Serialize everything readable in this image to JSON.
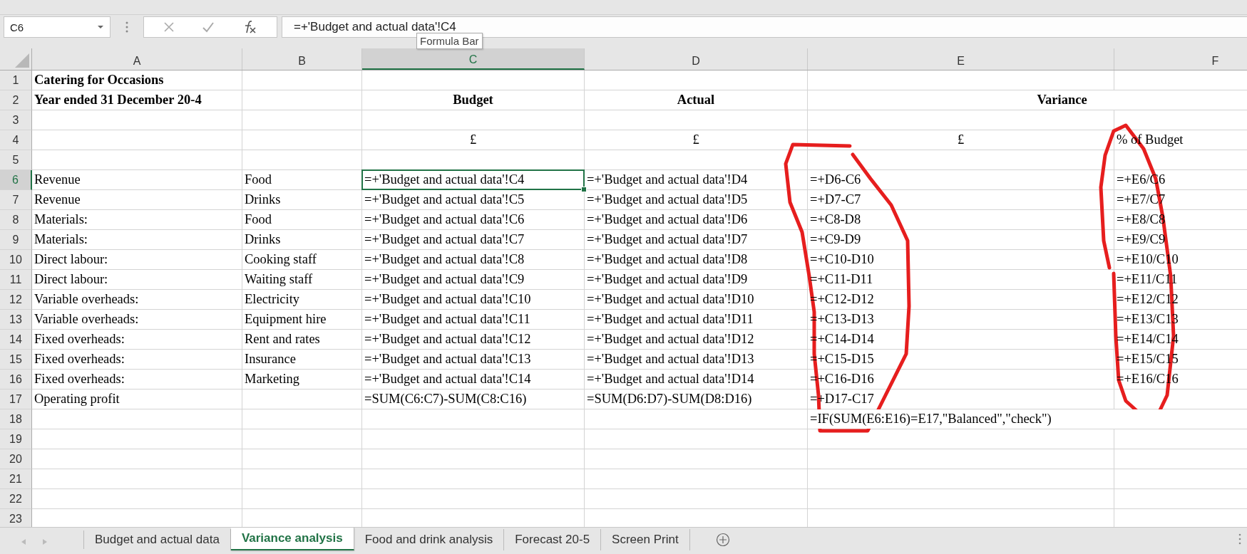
{
  "name_box": {
    "value": "C6"
  },
  "formula_bar": {
    "value": "=+'Budget and actual data'!C4",
    "tooltip": "Formula Bar"
  },
  "columns": [
    {
      "label": "A",
      "selected": false
    },
    {
      "label": "B",
      "selected": false
    },
    {
      "label": "C",
      "selected": true
    },
    {
      "label": "D",
      "selected": false
    },
    {
      "label": "E",
      "selected": false
    },
    {
      "label": "F",
      "selected": false
    }
  ],
  "rows": [
    {
      "number": "1",
      "selected": false,
      "cells": {
        "A": {
          "text": "Catering for Occasions",
          "bold": true
        }
      }
    },
    {
      "number": "2",
      "selected": false,
      "cells": {
        "A": {
          "text": "Year ended 31 December 20-4",
          "bold": true
        },
        "C": {
          "text": "Budget",
          "bold": true,
          "centered": true
        },
        "D": {
          "text": "Actual",
          "bold": true,
          "centered": true
        },
        "E": {
          "text": "Variance",
          "bold": true,
          "centered": true,
          "merged": true
        }
      }
    },
    {
      "number": "3",
      "selected": false,
      "cells": {}
    },
    {
      "number": "4",
      "selected": false,
      "cells": {
        "C": {
          "text": "£",
          "centered": true
        },
        "D": {
          "text": "£",
          "centered": true
        },
        "E": {
          "text": "£",
          "centered": true
        },
        "F": "% of Budget"
      }
    },
    {
      "number": "5",
      "selected": false,
      "cells": {}
    },
    {
      "number": "6",
      "selected": true,
      "cells": {
        "A": "Revenue",
        "B": "Food",
        "C": {
          "text": "=+'Budget and actual data'!C4",
          "selected": true
        },
        "D": "=+'Budget and actual data'!D4",
        "E": "=+D6-C6",
        "F": "=+E6/C6"
      }
    },
    {
      "number": "7",
      "selected": false,
      "cells": {
        "A": "Revenue",
        "B": "Drinks",
        "C": "=+'Budget and actual data'!C5",
        "D": "=+'Budget and actual data'!D5",
        "E": "=+D7-C7",
        "F": "=+E7/C7"
      }
    },
    {
      "number": "8",
      "selected": false,
      "cells": {
        "A": "Materials:",
        "B": "Food",
        "C": "=+'Budget and actual data'!C6",
        "D": "=+'Budget and actual data'!D6",
        "E": "=+C8-D8",
        "F": "=+E8/C8"
      }
    },
    {
      "number": "9",
      "selected": false,
      "cells": {
        "A": "Materials:",
        "B": "Drinks",
        "C": "=+'Budget and actual data'!C7",
        "D": "=+'Budget and actual data'!D7",
        "E": "=+C9-D9",
        "F": "=+E9/C9"
      }
    },
    {
      "number": "10",
      "selected": false,
      "cells": {
        "A": "Direct labour:",
        "B": "Cooking staff",
        "C": "=+'Budget and actual data'!C8",
        "D": "=+'Budget and actual data'!D8",
        "E": "=+C10-D10",
        "F": "=+E10/C10"
      }
    },
    {
      "number": "11",
      "selected": false,
      "cells": {
        "A": "Direct labour:",
        "B": "Waiting staff",
        "C": "=+'Budget and actual data'!C9",
        "D": "=+'Budget and actual data'!D9",
        "E": "=+C11-D11",
        "F": "=+E11/C11"
      }
    },
    {
      "number": "12",
      "selected": false,
      "cells": {
        "A": "Variable overheads:",
        "B": "Electricity",
        "C": "=+'Budget and actual data'!C10",
        "D": "=+'Budget and actual data'!D10",
        "E": "=+C12-D12",
        "F": "=+E12/C12"
      }
    },
    {
      "number": "13",
      "selected": false,
      "cells": {
        "A": "Variable overheads:",
        "B": "Equipment hire",
        "C": "=+'Budget and actual data'!C11",
        "D": "=+'Budget and actual data'!D11",
        "E": "=+C13-D13",
        "F": "=+E13/C13"
      }
    },
    {
      "number": "14",
      "selected": false,
      "cells": {
        "A": "Fixed overheads:",
        "B": "Rent and rates",
        "C": "=+'Budget and actual data'!C12",
        "D": "=+'Budget and actual data'!D12",
        "E": "=+C14-D14",
        "F": "=+E14/C14"
      }
    },
    {
      "number": "15",
      "selected": false,
      "cells": {
        "A": "Fixed overheads:",
        "B": "Insurance",
        "C": "=+'Budget and actual data'!C13",
        "D": "=+'Budget and actual data'!D13",
        "E": "=+C15-D15",
        "F": "=+E15/C15"
      }
    },
    {
      "number": "16",
      "selected": false,
      "cells": {
        "A": "Fixed overheads:",
        "B": "Marketing",
        "C": "=+'Budget and actual data'!C14",
        "D": "=+'Budget and actual data'!D14",
        "E": "=+C16-D16",
        "F": "=+E16/C16"
      }
    },
    {
      "number": "17",
      "selected": false,
      "cells": {
        "A": "Operating profit",
        "C": "=SUM(C6:C7)-SUM(C8:C16)",
        "D": "=SUM(D6:D7)-SUM(D8:D16)",
        "E": "=+D17-C17"
      }
    },
    {
      "number": "18",
      "selected": false,
      "cells": {
        "E": {
          "text": "=IF(SUM(E6:E16)=E17,\"Balanced\",\"check\")",
          "merged": true
        }
      }
    },
    {
      "number": "19",
      "selected": false,
      "cells": {}
    },
    {
      "number": "20",
      "selected": false,
      "cells": {}
    },
    {
      "number": "21",
      "selected": false,
      "cells": {}
    },
    {
      "number": "22",
      "selected": false,
      "cells": {}
    },
    {
      "number": "23",
      "selected": false,
      "cells": {}
    }
  ],
  "sheet_tabs": [
    {
      "label": "Budget and actual data",
      "selected": false
    },
    {
      "label": "Variance analysis",
      "selected": true
    },
    {
      "label": "Food and drink analysis",
      "selected": false
    },
    {
      "label": "Forecast 20-5",
      "selected": false
    },
    {
      "label": "Screen Print",
      "selected": false
    }
  ]
}
